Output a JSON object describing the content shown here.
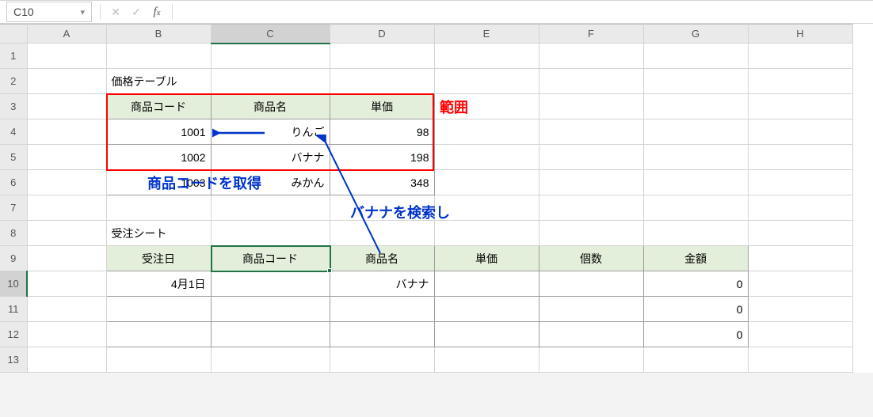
{
  "formula_bar": {
    "cell_ref": "C10",
    "formula": ""
  },
  "columns": [
    "A",
    "B",
    "C",
    "D",
    "E",
    "F",
    "G",
    "H"
  ],
  "rows": [
    "1",
    "2",
    "3",
    "4",
    "5",
    "6",
    "7",
    "8",
    "9",
    "10",
    "11",
    "12",
    "13"
  ],
  "section_titles": {
    "price_table": "価格テーブル",
    "orders": "受注シート"
  },
  "price_table": {
    "headers": {
      "code": "商品コード",
      "name": "商品名",
      "price": "単価"
    },
    "rows": [
      {
        "code": "1001",
        "name": "りんご",
        "price": "98"
      },
      {
        "code": "1002",
        "name": "バナナ",
        "price": "198"
      },
      {
        "code": "1003",
        "name": "みかん",
        "price": "348"
      }
    ]
  },
  "order_table": {
    "headers": {
      "date": "受注日",
      "code": "商品コード",
      "name": "商品名",
      "price": "単価",
      "qty": "個数",
      "amount": "金額"
    },
    "rows": [
      {
        "date": "4月1日",
        "code": "",
        "name": "バナナ",
        "price": "",
        "qty": "",
        "amount": "0"
      },
      {
        "date": "",
        "code": "",
        "name": "",
        "price": "",
        "qty": "",
        "amount": "0"
      },
      {
        "date": "",
        "code": "",
        "name": "",
        "price": "",
        "qty": "",
        "amount": "0"
      }
    ]
  },
  "annotations": {
    "range": "範囲",
    "get_code": "商品コードを取得",
    "search_banana": "バナナを検索し"
  },
  "selected_col": "C",
  "selected_row": "10"
}
